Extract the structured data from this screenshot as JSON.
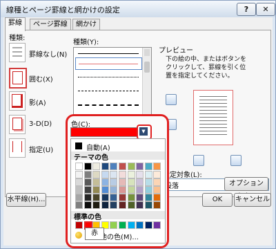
{
  "dialog": {
    "title": "線種とページ罫線と網かけの設定",
    "help_label": "?",
    "close_label": "✕"
  },
  "tabs": [
    {
      "label": "罫線"
    },
    {
      "label": "ページ罫線"
    },
    {
      "label": "網かけ"
    }
  ],
  "settings": {
    "label": "種類:",
    "items": [
      {
        "label": "罫線なし(N)"
      },
      {
        "label": "囲む(X)"
      },
      {
        "label": "影(A)"
      },
      {
        "label": "3-D(D)"
      },
      {
        "label": "指定(U)"
      }
    ]
  },
  "style": {
    "label": "種類(Y):"
  },
  "preview": {
    "label": "プレビュー",
    "help_text": [
      "下の絵の中、またはボタンを",
      "クリックして、罫線を引く位",
      "置を指定してください。"
    ]
  },
  "color": {
    "label": "色(C):",
    "selected_value": "#ff0000"
  },
  "apply": {
    "label": "設定対象(L):",
    "value": "段落"
  },
  "options_button": "オプション(O)...",
  "footer": {
    "horizontal_line": "水平線(H)...",
    "ok": "OK",
    "cancel": "キャンセル"
  },
  "color_menu": {
    "auto_label": "自動(A)",
    "theme_header": "テーマの色",
    "standard_header": "標準の色",
    "more_colors": "その他の色(M)...",
    "theme_columns": [
      [
        "#ffffff",
        "#f2f2f2",
        "#d9d9d9",
        "#bfbfbf",
        "#a6a6a6",
        "#808080"
      ],
      [
        "#000000",
        "#7f7f7f",
        "#595959",
        "#404040",
        "#262626",
        "#0d0d0d"
      ],
      [
        "#eeece1",
        "#ddd9c3",
        "#c4bd97",
        "#948a54",
        "#4a452a",
        "#1e1c11"
      ],
      [
        "#1f497d",
        "#c6d9f0",
        "#8db3e2",
        "#548dd4",
        "#17365d",
        "#0f243e"
      ],
      [
        "#4f81bd",
        "#dbe5f1",
        "#b8cce4",
        "#95b3d7",
        "#366092",
        "#244061"
      ],
      [
        "#c0504d",
        "#f2dcdb",
        "#e5b9b7",
        "#d99694",
        "#953734",
        "#632423"
      ],
      [
        "#9bbb59",
        "#ebf1dd",
        "#d7e3bc",
        "#c3d69b",
        "#76923c",
        "#4f6128"
      ],
      [
        "#8064a2",
        "#e5e0ec",
        "#ccc1d9",
        "#b2a2c7",
        "#5f497a",
        "#3f3151"
      ],
      [
        "#4bacc6",
        "#dbeef3",
        "#b7dde8",
        "#92cddc",
        "#31859b",
        "#205867"
      ],
      [
        "#f79646",
        "#fdeada",
        "#fbd5b5",
        "#fac08f",
        "#e36c09",
        "#974806"
      ]
    ],
    "standard_colors": [
      "#c00000",
      "#ff0000",
      "#ffc000",
      "#ffff00",
      "#92d050",
      "#00b050",
      "#00b0f0",
      "#0070c0",
      "#002060",
      "#7030a0"
    ],
    "tooltip": "赤"
  }
}
